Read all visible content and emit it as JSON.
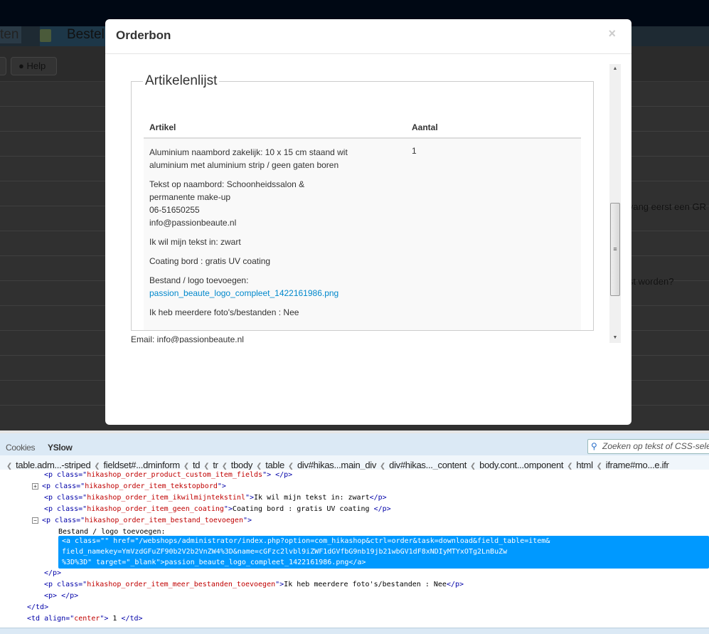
{
  "background": {
    "nav_menu": "ten",
    "nav_orders": "Bestel",
    "help_button": "Help",
    "row_text_1": "ntvang eerst een GR",
    "row_text_2": "atst worden?"
  },
  "modal": {
    "title": "Orderbon",
    "close": "×",
    "fieldset_legend": "Artikelenlijst",
    "columns": [
      "Artikel",
      "Aantal"
    ],
    "item": {
      "description": "Aluminium naambord zakelijk: 10 x 15 cm staand wit aluminium met aluminium strip / geen gaten boren",
      "text_on_sign_label": "Tekst op naambord: Schoonheidssalon &",
      "text_on_sign_lines": [
        "permanente make-up",
        "06-51650255",
        "info@passionbeaute.nl"
      ],
      "text_color": "Ik wil mijn tekst in: zwart",
      "coating": "Coating bord : gratis UV coating",
      "file_label": "Bestand / logo toevoegen:",
      "file_link": "passion_beaute_logo_compleet_1422161986.png",
      "more_files": "Ik heb meerdere foto's/bestanden : Nee",
      "quantity": "1"
    },
    "email": "Email: info@passionbeaute.nl"
  },
  "devtools": {
    "tabs": [
      "Cookies",
      "YSlow"
    ],
    "search_placeholder": "Zoeken op tekst of CSS-selec",
    "breadcrumbs": [
      "table.adm...-striped",
      "fieldset#...dminform",
      "td",
      "tr",
      "tbody",
      "table",
      "div#hikas...main_div",
      "div#hikas..._content",
      "body.cont...omponent",
      "html",
      "iframe#mo...e.ifr"
    ],
    "code": {
      "l0a": "<p class=\"",
      "l0b": "hikashop_order_product_custom_item_fields",
      "l0c": "\"> </p>",
      "l1a": "<p class=\"",
      "l1b": "hikashop_order_item_tekstopbord",
      "l1c": "\">",
      "l2a": "<p class=\"",
      "l2b": "hikashop_order_item_ikwilmijntekstinl",
      "l2c": "\">",
      "l2d": "Ik wil mijn tekst in: zwart",
      "l2e": "</p>",
      "l3a": "<p class=\"",
      "l3b": "hikashop_order_item_geen_coating",
      "l3c": "\">",
      "l3d": "Coating bord : gratis UV coating ",
      "l3e": "</p>",
      "l4a": "<p class=\"",
      "l4b": "hikashop_order_item_bestand_toevoegen",
      "l4c": "\">",
      "l5": "Bestand / logo toevoegen:",
      "sel1": "<a class=\"\" href=\"/webshops/administrator/index.php?option=com_hikashop&ctrl=order&task=download&field_table=item&",
      "sel2": "field_namekey=YmVzdGFuZF90b2V2b2VnZW4%3D&name=cGFzc2lvbl9iZWF1dGVfbG9nb19jb21wbGV1dF8xNDIyMTYxOTg2LnBuZw",
      "sel3": "%3D%3D\" target=\"_blank\">passion_beaute_logo_compleet_1422161986.png</a>",
      "l6": "</p>",
      "l7a": "<p class=\"",
      "l7b": "hikashop_order_item_meer_bestanden_toevoegen",
      "l7c": "\">",
      "l7d": "Ik heb meerdere foto's/bestanden : Nee",
      "l7e": "</p>",
      "l8": "<p> </p>",
      "l9": "</td>",
      "l10a": "<td align=\"",
      "l10b": "center",
      "l10c": "\">",
      "l10d": " 1 ",
      "l10e": "</td>"
    }
  },
  "colors": {
    "link": "#0088cc",
    "selection": "#0099ff",
    "overlay_bg": "#303030"
  }
}
